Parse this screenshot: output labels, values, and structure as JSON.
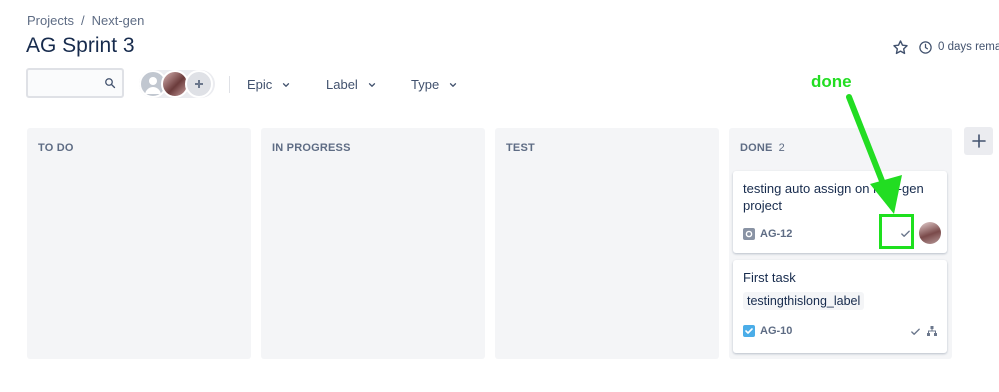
{
  "breadcrumb": {
    "items": [
      "Projects",
      "Next-gen"
    ],
    "separator": "/"
  },
  "page_title": "AG Sprint 3",
  "header": {
    "days_remaining": "0 days remai"
  },
  "toolbar": {
    "search_placeholder": "",
    "filters": [
      {
        "label": "Epic"
      },
      {
        "label": "Label"
      },
      {
        "label": "Type"
      }
    ]
  },
  "board": {
    "columns": [
      {
        "title": "TO DO",
        "count": ""
      },
      {
        "title": "IN PROGRESS",
        "count": ""
      },
      {
        "title": "TEST",
        "count": ""
      },
      {
        "title": "DONE",
        "count": "2"
      }
    ],
    "cards": [
      {
        "title": "testing auto assign on next-gen project",
        "key": "AG-12",
        "type_icon": "story-icon",
        "label": ""
      },
      {
        "title": "First task",
        "key": "AG-10",
        "type_icon": "task-checkbox-icon",
        "label": "testingthislong_label"
      }
    ]
  },
  "annotation": {
    "text": "done"
  },
  "colors": {
    "text": "#172b4d",
    "muted": "#5e6c84",
    "column_bg": "#f4f5f7",
    "task_icon": "#4bade8",
    "annotation": "#22dd22"
  }
}
